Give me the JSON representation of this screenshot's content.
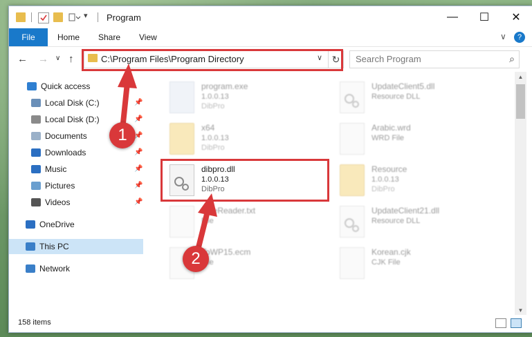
{
  "window": {
    "title": "Program",
    "controls": {
      "minimize": "—",
      "maximize": "☐",
      "close": "✕"
    }
  },
  "ribbon": {
    "tabs": [
      "File",
      "Home",
      "Share",
      "View"
    ],
    "expand": "∨",
    "help": "?"
  },
  "nav": {
    "back": "←",
    "forward": "→",
    "recent": "∨",
    "up": "↑",
    "address": "C:\\Program Files\\Program Directory",
    "address_dropdown": "∨",
    "refresh": "↻",
    "search_placeholder": "Search Program",
    "search_icon": "⌕"
  },
  "sidebar": {
    "items": [
      {
        "label": "Quick access",
        "icon": "star-icon",
        "color": "#2f7fd1"
      },
      {
        "label": "Local Disk (C:)",
        "icon": "drive-icon",
        "color": "#6a8fb8",
        "pinned": true
      },
      {
        "label": "Local Disk (D:)",
        "icon": "drive-icon",
        "color": "#8a8a8a",
        "pinned": true
      },
      {
        "label": "Documents",
        "icon": "documents-icon",
        "color": "#9ab0c8",
        "pinned": true
      },
      {
        "label": "Downloads",
        "icon": "downloads-icon",
        "color": "#2b6fc2",
        "pinned": true
      },
      {
        "label": "Music",
        "icon": "music-icon",
        "color": "#2b6fc2",
        "pinned": true
      },
      {
        "label": "Pictures",
        "icon": "pictures-icon",
        "color": "#6a9fcf",
        "pinned": true
      },
      {
        "label": "Videos",
        "icon": "videos-icon",
        "color": "#555",
        "pinned": true
      },
      {
        "label": "OneDrive",
        "icon": "onedrive-icon",
        "color": "#2b6fc2"
      },
      {
        "label": "This PC",
        "icon": "computer-icon",
        "color": "#3a7fc8",
        "selected": true
      },
      {
        "label": "Network",
        "icon": "network-icon",
        "color": "#3a7fc8"
      }
    ],
    "pin_glyph": "📌"
  },
  "files": [
    {
      "name": "program.exe",
      "version": "1.0.0.13",
      "company": "DibPro",
      "kind": "exe"
    },
    {
      "name": "UpdateClient5.dll",
      "version": "Resource DLL",
      "company": "",
      "kind": "dll"
    },
    {
      "name": "x64",
      "version": "1.0.0.13",
      "company": "DibPro",
      "kind": "folder"
    },
    {
      "name": "Arabic.wrd",
      "version": "WRD File",
      "company": "",
      "kind": "file"
    },
    {
      "name": "dibpro.dll",
      "version": "1.0.0.13",
      "company": "DibPro",
      "kind": "dll"
    },
    {
      "name": "Resource",
      "version": "1.0.0.13",
      "company": "DibPro",
      "kind": "folder"
    },
    {
      "name": "FineReader.txt",
      "version": "File",
      "company": "",
      "kind": "file"
    },
    {
      "name": "UpdateClient21.dll",
      "version": "Resource DLL",
      "company": "",
      "kind": "dll"
    },
    {
      "name": "ToWP15.ecm",
      "version": "File",
      "company": "",
      "kind": "file"
    },
    {
      "name": "Korean.cjk",
      "version": "CJK File",
      "company": "",
      "kind": "file"
    }
  ],
  "status": {
    "count": "158 items"
  },
  "annotations": {
    "step1": "1",
    "step2": "2",
    "color": "#d9383a"
  }
}
